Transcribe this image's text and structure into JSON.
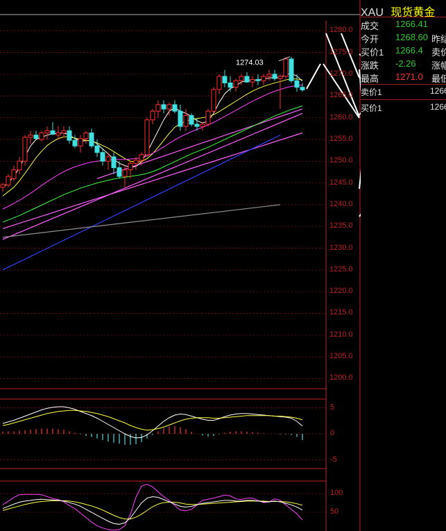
{
  "quote": {
    "symbol": "XAU",
    "name": "现货黄金",
    "rows": [
      {
        "label": "成交",
        "value": "1266.41",
        "extra": ""
      },
      {
        "label": "今开",
        "value": "1268.60",
        "extra": "昨结"
      },
      {
        "label": "买价1",
        "value": "1266.4",
        "extra": "卖价"
      },
      {
        "label": "涨跌",
        "value": "-2.26",
        "extra": "涨幅"
      },
      {
        "label": "最高",
        "value": "1271.0",
        "extra": "最低"
      }
    ],
    "sell_label": "卖价1",
    "sell_value": "1266",
    "buy_label": "买价1",
    "buy_value": "1266",
    "colors": {
      "green": "#2ec82e",
      "red": "#ff3030",
      "yellow": "#ffff00"
    }
  },
  "chart_data": [
    {
      "type": "candlestick",
      "title": "",
      "ylim": [
        1198,
        1281
      ],
      "y_ticks": [
        "1280.0",
        "1275.0",
        "1270.0",
        "1265.0",
        "1260.0",
        "1255.0",
        "1250.0",
        "1245.0",
        "1240.0",
        "1235.0",
        "1230.0",
        "1225.0",
        "1220.0",
        "1215.0",
        "1210.0",
        "1205.0",
        "1200.0"
      ],
      "annotation": "1274.03",
      "grid": true,
      "candles": [
        [
          1244,
          1245,
          1243,
          1244.6
        ],
        [
          1244.5,
          1247,
          1244,
          1246.5
        ],
        [
          1246,
          1249,
          1245.5,
          1248
        ],
        [
          1248,
          1251,
          1247,
          1250
        ],
        [
          1250,
          1256,
          1249,
          1255.5
        ],
        [
          1255.5,
          1257,
          1254,
          1256
        ],
        [
          1256,
          1257,
          1255,
          1255.2
        ],
        [
          1255,
          1257,
          1254.5,
          1256.5
        ],
        [
          1256.5,
          1258,
          1255,
          1257
        ],
        [
          1257,
          1259,
          1256,
          1256.2
        ],
        [
          1256,
          1258,
          1255,
          1256.5
        ],
        [
          1256.5,
          1258,
          1255.5,
          1257
        ],
        [
          1257,
          1258,
          1254,
          1254.8
        ],
        [
          1254.8,
          1256,
          1253,
          1253.5
        ],
        [
          1253.5,
          1256,
          1252,
          1255.2
        ],
        [
          1255.2,
          1257,
          1254,
          1256.5
        ],
        [
          1256.5,
          1257.5,
          1253,
          1253.5
        ],
        [
          1253.5,
          1255,
          1251,
          1252
        ],
        [
          1252,
          1253,
          1249,
          1250
        ],
        [
          1250,
          1252,
          1248,
          1251
        ],
        [
          1251,
          1252,
          1247,
          1248.5
        ],
        [
          1248.5,
          1250,
          1246,
          1246.5
        ],
        [
          1246.5,
          1249,
          1244,
          1248
        ],
        [
          1248,
          1250,
          1246,
          1249.5
        ],
        [
          1249.5,
          1251,
          1248,
          1250.2
        ],
        [
          1250.2,
          1252,
          1249,
          1251.5
        ],
        [
          1251.5,
          1260,
          1251,
          1259.5
        ],
        [
          1259.5,
          1262,
          1258.5,
          1261.5
        ],
        [
          1261.5,
          1264,
          1260,
          1263
        ],
        [
          1263,
          1264,
          1261,
          1262
        ],
        [
          1262,
          1263.5,
          1260.5,
          1263
        ],
        [
          1263,
          1264,
          1261,
          1261.5
        ],
        [
          1261.5,
          1263,
          1257,
          1258
        ],
        [
          1258,
          1262,
          1257,
          1260.5
        ],
        [
          1260.5,
          1261,
          1258,
          1258.5
        ],
        [
          1258.5,
          1260,
          1257,
          1258
        ],
        [
          1258,
          1259,
          1257,
          1258.5
        ],
        [
          1258.5,
          1262,
          1258,
          1261.5
        ],
        [
          1261.5,
          1267,
          1261,
          1266.5
        ],
        [
          1266.5,
          1270,
          1265.5,
          1269.5
        ],
        [
          1269.5,
          1271,
          1267,
          1268
        ],
        [
          1268,
          1269.5,
          1266,
          1267
        ],
        [
          1267,
          1269,
          1266,
          1268.5
        ],
        [
          1268.5,
          1270,
          1267.5,
          1269.5
        ],
        [
          1269.5,
          1270.5,
          1268,
          1268.2
        ],
        [
          1268.2,
          1269.5,
          1267,
          1268.8
        ],
        [
          1268.8,
          1270,
          1267.5,
          1268.5
        ],
        [
          1268.5,
          1270,
          1267.5,
          1269.5
        ],
        [
          1269.5,
          1271,
          1268.5,
          1270
        ],
        [
          1270,
          1271,
          1268.5,
          1269
        ],
        [
          1269,
          1270,
          1262,
          1269.5
        ],
        [
          1269.5,
          1274,
          1269,
          1273.5
        ],
        [
          1273.5,
          1274.03,
          1268,
          1268.5
        ],
        [
          1268.5,
          1270,
          1266,
          1267
        ],
        [
          1267,
          1268,
          1266,
          1266.4
        ]
      ],
      "ma_series": [
        {
          "color": "#ffffff",
          "values": [
            1244,
            1245,
            1246.5,
            1248.5,
            1251,
            1253.5,
            1255,
            1255.5,
            1256,
            1256.3,
            1256.4,
            1256.5,
            1256,
            1255.2,
            1254.6,
            1254.7,
            1254.8,
            1254,
            1252.8,
            1251.7,
            1250.5,
            1249.5,
            1249,
            1248.6,
            1248.8,
            1249.8,
            1252,
            1254.5,
            1257,
            1259.5,
            1261.5,
            1262.3,
            1261.5,
            1261,
            1260.3,
            1259.3,
            1258.8,
            1259.2,
            1261,
            1263.5,
            1265.5,
            1266.7,
            1267.3,
            1268.2,
            1268.5,
            1268.6,
            1268.7,
            1268.9,
            1269.1,
            1269.3,
            1269.2,
            1270,
            1270.1,
            1269.6,
            1268.4
          ]
        },
        {
          "color": "#ffff40",
          "values": [
            1242,
            1243,
            1244,
            1245.5,
            1247.2,
            1249,
            1250.8,
            1252.3,
            1253.6,
            1254.5,
            1255.2,
            1255.6,
            1255.6,
            1255.3,
            1255,
            1254.8,
            1254.6,
            1254.2,
            1253.6,
            1253,
            1252.2,
            1251.4,
            1250.6,
            1250,
            1249.8,
            1249.9,
            1250.6,
            1251.7,
            1253.2,
            1254.8,
            1256.4,
            1257.8,
            1258.6,
            1259.2,
            1259.6,
            1259.8,
            1260,
            1260.2,
            1260.7,
            1261.4,
            1262.2,
            1263,
            1263.8,
            1264.6,
            1265.4,
            1266.1,
            1266.7,
            1267.2,
            1267.6,
            1268,
            1268.3,
            1268.7,
            1268.9,
            1268.9,
            1268.7
          ]
        },
        {
          "color": "#ff40ff",
          "values": [
            1239,
            1239.6,
            1240.3,
            1241,
            1241.8,
            1242.6,
            1243.5,
            1244.4,
            1245.3,
            1246.1,
            1246.9,
            1247.6,
            1248.2,
            1248.7,
            1249.1,
            1249.5,
            1249.8,
            1250,
            1250.2,
            1250.3,
            1250.4,
            1250.4,
            1250.4,
            1250.5,
            1250.6,
            1250.8,
            1251.2,
            1251.8,
            1252.5,
            1253.3,
            1254.1,
            1254.9,
            1255.6,
            1256.2,
            1256.8,
            1257.3,
            1257.8,
            1258.3,
            1258.9,
            1259.6,
            1260.3,
            1261,
            1261.7,
            1262.4,
            1263.1,
            1263.8,
            1264.4,
            1265,
            1265.6,
            1266.1,
            1266.5,
            1266.9,
            1267.2,
            1267.4,
            1267.5
          ]
        },
        {
          "color": "#40ff40",
          "values": [
            1236,
            1236.5,
            1237,
            1237.5,
            1238.1,
            1238.7,
            1239.3,
            1239.9,
            1240.5,
            1241.1,
            1241.7,
            1242.3,
            1242.8,
            1243.3,
            1243.8,
            1244.2,
            1244.6,
            1245,
            1245.3,
            1245.6,
            1245.9,
            1246.1,
            1246.3,
            1246.5,
            1246.7,
            1246.9,
            1247.2,
            1247.6,
            1248.1,
            1248.7,
            1249.3,
            1249.9,
            1250.5,
            1251.1,
            1251.7,
            1252.2,
            1252.7,
            1253.2,
            1253.8,
            1254.4,
            1255,
            1255.6,
            1256.2,
            1256.8,
            1257.4,
            1258,
            1258.6,
            1259.2,
            1259.8,
            1260.4,
            1260.9,
            1261.4,
            1261.9,
            1262.3,
            1262.7
          ]
        }
      ],
      "trend_lines": [
        {
          "color": "#ff60ff",
          "from": [
            0,
            1232
          ],
          "to": [
            54,
            1261
          ]
        },
        {
          "color": "#ff60ff",
          "from": [
            0,
            1234.5
          ],
          "to": [
            54,
            1256.5
          ]
        },
        {
          "color": "#ff60ff",
          "from": [
            17,
            1246
          ],
          "to": [
            54,
            1262
          ]
        },
        {
          "color": "#3040ff",
          "from": [
            0,
            1225
          ],
          "to": [
            50,
            1256
          ]
        },
        {
          "color": "#909090",
          "from": [
            0,
            1232.5
          ],
          "to": [
            50,
            1240
          ]
        }
      ]
    },
    {
      "type": "macd",
      "yticks": [
        "5",
        "0",
        "-5"
      ],
      "ylim": [
        -6,
        6
      ],
      "dif": [
        2,
        2.3,
        2.6,
        3,
        3.4,
        3.8,
        4.2,
        4.6,
        4.9,
        5.1,
        5.2,
        5.2,
        5,
        4.7,
        4.3,
        3.9,
        3.5,
        3,
        2.4,
        1.8,
        1.2,
        0.6,
        0,
        -0.5,
        -0.8,
        -0.7,
        -0.2,
        0.6,
        1.5,
        2.4,
        3.1,
        3.6,
        3.8,
        3.7,
        3.4,
        3.1,
        2.8,
        2.6,
        2.6,
        2.9,
        3.3,
        3.6,
        3.8,
        3.9,
        3.9,
        3.8,
        3.7,
        3.6,
        3.5,
        3.4,
        3.3,
        3.2,
        3,
        2.4,
        1.5
      ],
      "dea": [
        1.6,
        1.8,
        2.1,
        2.4,
        2.7,
        3,
        3.3,
        3.6,
        3.9,
        4.1,
        4.3,
        4.4,
        4.5,
        4.5,
        4.4,
        4.3,
        4.1,
        3.9,
        3.6,
        3.3,
        2.9,
        2.5,
        2.1,
        1.6,
        1.2,
        0.9,
        0.7,
        0.8,
        1,
        1.3,
        1.7,
        2.1,
        2.5,
        2.8,
        3,
        3.1,
        3.1,
        3.1,
        3,
        3,
        3.1,
        3.2,
        3.3,
        3.4,
        3.5,
        3.5,
        3.5,
        3.5,
        3.5,
        3.4,
        3.4,
        3.3,
        3.2,
        3,
        2.7
      ],
      "hist": [
        0.4,
        0.5,
        0.5,
        0.6,
        0.7,
        0.8,
        0.9,
        1,
        1,
        1,
        0.9,
        0.8,
        0.5,
        0.2,
        -0.1,
        -0.4,
        -0.6,
        -0.9,
        -1.2,
        -1.5,
        -1.7,
        -1.9,
        -2.1,
        -2.1,
        -2,
        -1.6,
        -0.9,
        -0.2,
        0.5,
        1.1,
        1.4,
        1.5,
        1.3,
        0.9,
        0.4,
        0,
        -0.3,
        -0.5,
        -0.4,
        -0.1,
        0.2,
        0.4,
        0.5,
        0.5,
        0.4,
        0.3,
        0.2,
        0.1,
        0,
        0,
        -0.1,
        -0.1,
        -0.2,
        -0.6,
        -1.2
      ]
    },
    {
      "type": "kdj",
      "yticks": [
        "100",
        "50"
      ],
      "ylim": [
        0,
        130
      ],
      "k": [
        60,
        66,
        72,
        77,
        80,
        82,
        84,
        85,
        84,
        83,
        82,
        80,
        76,
        72,
        66,
        58,
        50,
        42,
        34,
        26,
        20,
        18,
        22,
        35,
        55,
        75,
        88,
        92,
        90,
        84,
        78,
        72,
        66,
        64,
        66,
        70,
        74,
        76,
        78,
        80,
        82,
        82,
        80,
        80,
        82,
        82,
        80,
        78,
        78,
        80,
        78,
        74,
        70,
        64,
        56
      ],
      "d": [
        55,
        59,
        63,
        67,
        71,
        74,
        77,
        79,
        80,
        81,
        81,
        81,
        80,
        78,
        75,
        71,
        67,
        62,
        56,
        49,
        42,
        36,
        32,
        32,
        37,
        45,
        55,
        65,
        72,
        76,
        77,
        77,
        75,
        72,
        71,
        71,
        72,
        73,
        74,
        75,
        76,
        77,
        78,
        79,
        80,
        80,
        80,
        80,
        79,
        79,
        79,
        78,
        76,
        73,
        69
      ],
      "j": [
        70,
        80,
        90,
        97,
        98,
        98,
        98,
        97,
        92,
        87,
        84,
        78,
        68,
        60,
        48,
        36,
        24,
        14,
        8,
        4,
        2,
        4,
        14,
        45,
        90,
        120,
        125,
        118,
        105,
        92,
        82,
        68,
        56,
        54,
        58,
        70,
        82,
        85,
        88,
        92,
        96,
        94,
        86,
        84,
        88,
        88,
        82,
        76,
        78,
        86,
        82,
        70,
        58,
        46,
        30
      ]
    }
  ]
}
